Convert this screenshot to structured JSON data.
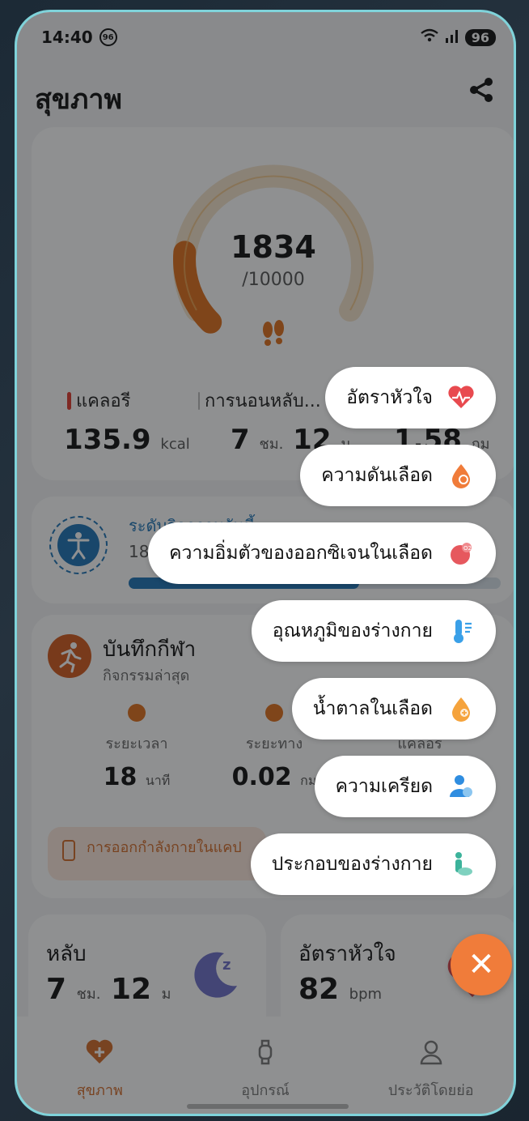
{
  "status": {
    "time": "14:40",
    "badge": "96",
    "battery": "96"
  },
  "page_title": "สุขภาพ",
  "steps": {
    "value": "1834",
    "goal": "/10000",
    "progress": 0.1834
  },
  "stats": [
    {
      "label": "แคลอรี",
      "value": "135.9",
      "unit": "kcal"
    },
    {
      "label": "การนอนหลับ...",
      "value": "7",
      "unit1": "ชม.",
      "value2": "12",
      "unit2": "ม"
    },
    {
      "label": "",
      "value": "1.58",
      "unit": "กม"
    }
  ],
  "activity": {
    "title": "ระดับกิจกรรมวันนี้",
    "subtitle": "1834 ก้าว",
    "progress": 0.62
  },
  "exercise": {
    "title": "บันทึกกีฬา",
    "subtitle": "กิจกรรมล่าสุด",
    "cols": [
      {
        "label": "ระยะเวลา",
        "value": "18",
        "unit": "นาที"
      },
      {
        "label": "ระยะทาง",
        "value": "0.02",
        "unit": "กม"
      },
      {
        "label": "แคลอรี",
        "value": "",
        "unit": ""
      }
    ],
    "chip": "การออกกำลังกายในแคป"
  },
  "sleep_card": {
    "title": "หลับ",
    "value": "7",
    "unit1": "ชม.",
    "value2": "12",
    "unit2": "ม"
  },
  "heart_card": {
    "title": "อัตราหัวใจ",
    "value": "82",
    "unit": "bpm"
  },
  "tabs": [
    {
      "label": "สุขภาพ",
      "active": true
    },
    {
      "label": "อุปกรณ์",
      "active": false
    },
    {
      "label": "ประวัติโดยย่อ",
      "active": false
    }
  ],
  "menu": [
    {
      "label": "อัตราหัวใจ",
      "icon": "heart-rate-icon",
      "color": "#e84a4f"
    },
    {
      "label": "ความดันเลือด",
      "icon": "blood-pressure-icon",
      "color": "#f07c3a"
    },
    {
      "label": "ความอิ่มตัวของออกซิเจนในเลือด",
      "icon": "spo2-icon",
      "color": "#e6585e"
    },
    {
      "label": "อุณหภูมิของร่างกาย",
      "icon": "thermometer-icon",
      "color": "#3aa0e8"
    },
    {
      "label": "น้ำตาลในเลือด",
      "icon": "blood-sugar-icon",
      "color": "#f5a33c"
    },
    {
      "label": "ความเครียด",
      "icon": "stress-icon",
      "color": "#2f8de0"
    },
    {
      "label": "ประกอบของร่างกาย",
      "icon": "body-composition-icon",
      "color": "#3cb39b"
    }
  ],
  "colors": {
    "accent": "#d46b2a",
    "frame": "#7fd3da"
  }
}
